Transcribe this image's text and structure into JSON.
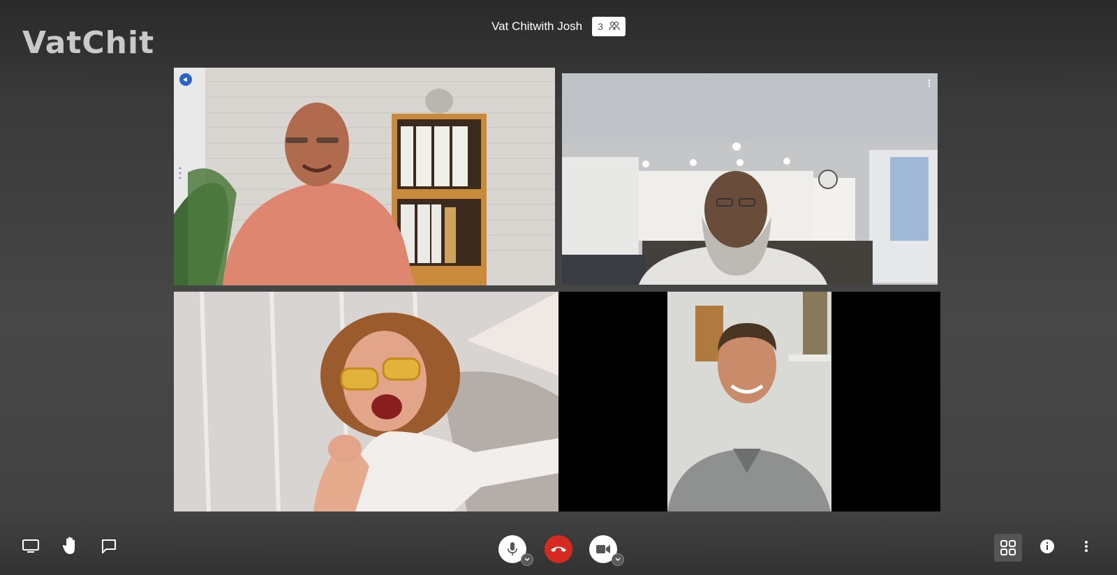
{
  "app": {
    "logo_text": "VatChit",
    "meeting_title": "Vat Chitwith Josh",
    "participant_count": "3"
  },
  "tiles": [
    {
      "name": "participant-man-pink-shirt",
      "active": true,
      "has_pin": true
    },
    {
      "name": "participant-man-beard",
      "active": false,
      "has_menu": true
    },
    {
      "name": "participant-woman-sunglasses",
      "active": false
    },
    {
      "name": "participant-man-gray-shirt",
      "active": false
    }
  ],
  "toolbar": {
    "left": [
      "screen-share",
      "raise-hand",
      "chat"
    ],
    "center": [
      "microphone",
      "end-call",
      "camera"
    ],
    "right": [
      "tile-view",
      "info",
      "more"
    ]
  },
  "colors": {
    "end_call": "#d6291f",
    "active_border": "#2a5fb0",
    "pin_badge": "#2b63c9"
  },
  "icons": [
    "users-icon",
    "desktop-icon",
    "hand-icon",
    "chat-icon",
    "mic-icon",
    "phone-icon",
    "video-icon",
    "grid-icon",
    "info-icon",
    "more-vertical-icon"
  ]
}
